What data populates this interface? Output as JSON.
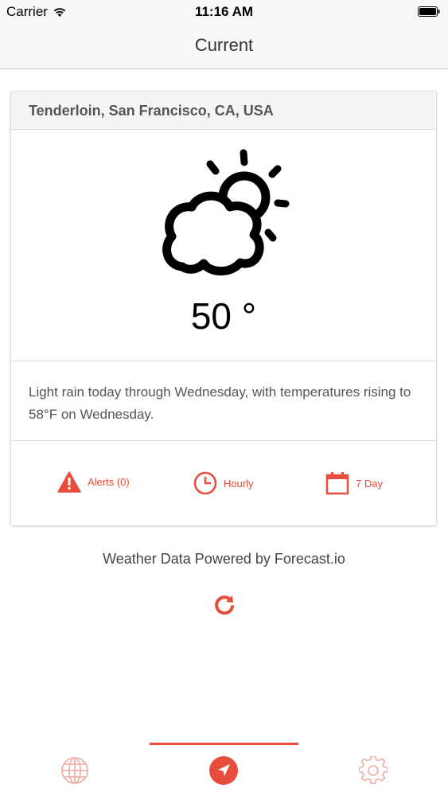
{
  "status_bar": {
    "carrier": "Carrier",
    "time": "11:16 AM"
  },
  "nav": {
    "title": "Current"
  },
  "weather": {
    "location": "Tenderloin, San Francisco, CA, USA",
    "icon": "partly-cloudy-icon",
    "temperature": "50 °",
    "summary": "Light rain today through Wednesday, with temperatures rising to 58°F on Wednesday."
  },
  "actions": {
    "alerts_label": "Alerts (0)",
    "hourly_label": "Hourly",
    "seven_day_label": "7 Day"
  },
  "footer": {
    "powered_by": "Weather Data Powered by Forecast.io"
  },
  "tabs": [
    {
      "icon": "globe-icon",
      "selected": false
    },
    {
      "icon": "location-arrow-icon",
      "selected": true
    },
    {
      "icon": "gear-icon",
      "selected": false
    }
  ],
  "colors": {
    "accent": "#e74c3c",
    "text_primary": "#000000",
    "text_secondary": "#555555",
    "card_header_bg": "#f5f5f5",
    "tab_inactive": "#f1a89f"
  }
}
